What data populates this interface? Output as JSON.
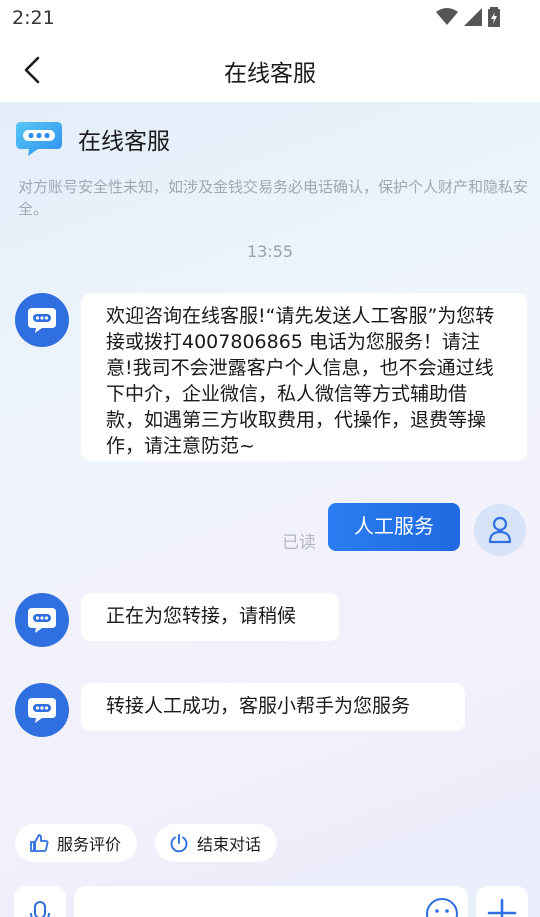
{
  "status_bar": {
    "time": "2:21"
  },
  "nav": {
    "title": "在线客服"
  },
  "service": {
    "name": "在线客服",
    "notice": "对方账号安全性未知，如涉及金钱交易务必电话确认，保护个人财产和隐私安全。"
  },
  "timestamp": "13:55",
  "messages": [
    {
      "from": "bot",
      "text": "欢迎咨询在线客服!“请先发送人工客服”为您转接或拨打4007806865 电话为您服务！请注意!我司不会泄露客户个人信息，也不会通过线下中介，企业微信，私人微信等方式辅助借款，如遇第三方收取费用，代操作，退费等操作，请注意防范~"
    },
    {
      "from": "user",
      "text": "人工服务",
      "status": "已读"
    },
    {
      "from": "bot",
      "text": "正在为您转接，请稍候"
    },
    {
      "from": "bot",
      "text": "转接人工成功，客服小帮手为您服务"
    }
  ],
  "actions": {
    "rate": "服务评价",
    "end": "结束对话"
  },
  "colors": {
    "accent": "#2f6fe0",
    "user_bubble": "#2b7cf2"
  },
  "icons": [
    "back-icon",
    "chat-bubble-icon",
    "user-icon",
    "thumbs-up-icon",
    "power-icon",
    "mic-icon",
    "emoji-icon",
    "plus-icon"
  ]
}
